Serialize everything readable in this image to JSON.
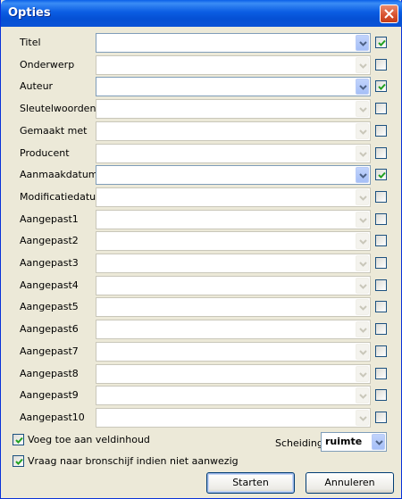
{
  "window": {
    "title": "Opties",
    "close_icon": "close-icon"
  },
  "fields": [
    {
      "label": "Titel",
      "enabled": true,
      "checked": true
    },
    {
      "label": "Onderwerp",
      "enabled": false,
      "checked": false
    },
    {
      "label": "Auteur",
      "enabled": true,
      "checked": true
    },
    {
      "label": "Sleutelwoorden",
      "enabled": false,
      "checked": false
    },
    {
      "label": "Gemaakt met",
      "enabled": false,
      "checked": false
    },
    {
      "label": "Producent",
      "enabled": false,
      "checked": false
    },
    {
      "label": "Aanmaakdatum",
      "enabled": true,
      "checked": true
    },
    {
      "label": "Modificatiedatum",
      "enabled": false,
      "checked": false
    },
    {
      "label": "Aangepast1",
      "enabled": false,
      "checked": false
    },
    {
      "label": "Aangepast2",
      "enabled": false,
      "checked": false
    },
    {
      "label": "Aangepast3",
      "enabled": false,
      "checked": false
    },
    {
      "label": "Aangepast4",
      "enabled": false,
      "checked": false
    },
    {
      "label": "Aangepast5",
      "enabled": false,
      "checked": false
    },
    {
      "label": "Aangepast6",
      "enabled": false,
      "checked": false
    },
    {
      "label": "Aangepast7",
      "enabled": false,
      "checked": false
    },
    {
      "label": "Aangepast8",
      "enabled": false,
      "checked": false
    },
    {
      "label": "Aangepast9",
      "enabled": false,
      "checked": false
    },
    {
      "label": "Aangepast10",
      "enabled": false,
      "checked": false
    }
  ],
  "options": {
    "add_to_field_label": "Voeg toe aan veldinhoud",
    "add_to_field_checked": true,
    "ask_source_label": "Vraag naar bronschijf indien niet aanwezig",
    "ask_source_checked": true,
    "separator_label": "Scheiding",
    "separator_value": "ruimte"
  },
  "buttons": {
    "start_label": "Starten",
    "cancel_label": "Annuleren"
  },
  "colors": {
    "titlebar": "#0a53d6",
    "checkmark": "#21a121",
    "dialog_bg": "#ece9d8"
  }
}
